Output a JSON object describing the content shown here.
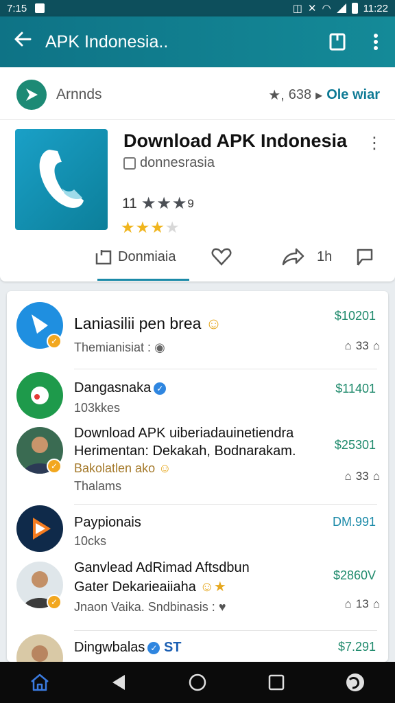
{
  "status": {
    "time_left": "7:15",
    "time_right": "11:22"
  },
  "appbar": {
    "title": "APK Indonesia.."
  },
  "brand": {
    "name": "Arnnds",
    "rating": "638",
    "link": "Ole wiar"
  },
  "app": {
    "title": "Download APK Indonesia",
    "developer": "donnesrasia",
    "rating_count": "11",
    "rating_suffix": "9",
    "stars_filled": 3,
    "stars_total": 4
  },
  "actions": {
    "download_label": "Donmiaia",
    "share_count": "1h"
  },
  "list": [
    {
      "title": "Laniasilii pen brea",
      "subtitle": "Themianisiat :",
      "price": "$10201",
      "count": "33"
    },
    {
      "title": "Dangasnaka",
      "subtitle": "103kkes",
      "price": "$11401"
    },
    {
      "title_line1": "Download APK uiberiadauinetiendra",
      "title_line2": "Herimentan: Dekakah, Bodnarakam.",
      "line3": "Bakolatlen ako",
      "subtitle": "Thalams",
      "price": "$25301",
      "count": "33"
    },
    {
      "title": "Paypionais",
      "subtitle": "10cks",
      "price": "DM.991"
    },
    {
      "title_line1": "Ganvlead AdRimad Aftsdbun",
      "title_line2": "Gater Dekarieaiiaha",
      "subtitle": "Jnaon Vaika. Sndbinasis :",
      "price": "$2860V",
      "count": "13"
    },
    {
      "title": "Dingwbalas",
      "title_suffix": "ST",
      "price": "$7.291"
    }
  ],
  "colors": {
    "appbar": "#0e7386",
    "accent": "#1b8aa8",
    "price": "#1f8a6c",
    "gold": "#f0b51e"
  }
}
